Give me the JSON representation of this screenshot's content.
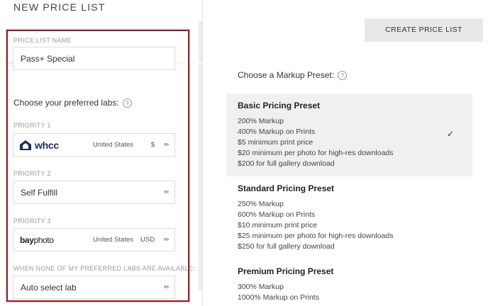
{
  "header": {
    "title": "NEW PRICE LIST",
    "create_button": "CREATE PRICE LIST"
  },
  "form": {
    "name_label": "PRICE LIST NAME",
    "name_value": "Pass+ Special",
    "choose_labs": "Choose your preferred labs:",
    "priorities": [
      {
        "label": "PRIORITY 1",
        "lab": "whcc",
        "country": "United States",
        "currency": "$"
      },
      {
        "label": "PRIORITY 2",
        "lab": "Self Fulfill",
        "country": "",
        "currency": ""
      },
      {
        "label": "PRIORITY 3",
        "lab_bold": "bay",
        "lab_rest": "photo",
        "country": "United States",
        "currency": "USD"
      }
    ],
    "fallback_label": "WHEN NONE OF MY PREFERRED LABS ARE AVAILABLE:",
    "fallback_value": "Auto select lab"
  },
  "markup": {
    "label": "Choose a Markup Preset:",
    "presets": [
      {
        "title": "Basic Pricing Preset",
        "selected": true,
        "lines": [
          "200% Markup",
          "400% Markup on Prints",
          "$5 minimum print price",
          "$20 minimum per photo for high-res downloads",
          "$200 for full gallery download"
        ]
      },
      {
        "title": "Standard Pricing Preset",
        "selected": false,
        "lines": [
          "250% Markup",
          "600% Markup on Prints",
          "$10 minimum print price",
          "$25 minimum per photo for high-res downloads",
          "$250 for full gallery download"
        ]
      },
      {
        "title": "Premium Pricing Preset",
        "selected": false,
        "lines": [
          "300% Markup",
          "1000% Markup on Prints"
        ]
      }
    ]
  },
  "colors": {
    "accent_border": "#8e2323",
    "selected_bg": "#f0f0f0",
    "button_bg": "#e8e8e8"
  }
}
